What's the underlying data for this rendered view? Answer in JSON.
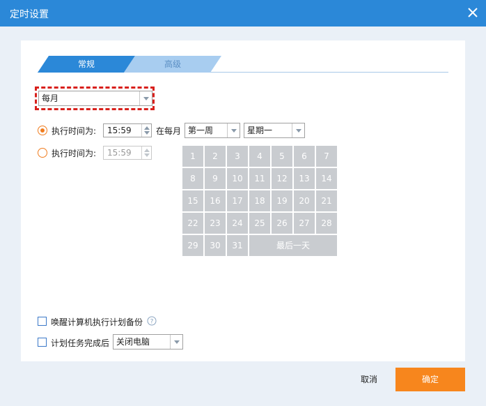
{
  "window": {
    "title": "定时设置"
  },
  "tabs": [
    {
      "label": "常规",
      "active": true
    },
    {
      "label": "高级",
      "active": false
    }
  ],
  "frequency": {
    "selected": "每月"
  },
  "radio_week": {
    "label": "执行时间为:",
    "selected": true,
    "time": "15:59",
    "each_month_label": "在每月",
    "week_selected": "第一周",
    "weekday_selected": "星期一"
  },
  "radio_day": {
    "label": "执行时间为:",
    "selected": false,
    "time": "15:59"
  },
  "calendar": {
    "days": [
      "1",
      "2",
      "3",
      "4",
      "5",
      "6",
      "7",
      "8",
      "9",
      "10",
      "11",
      "12",
      "13",
      "14",
      "15",
      "16",
      "17",
      "18",
      "19",
      "20",
      "21",
      "22",
      "23",
      "24",
      "25",
      "26",
      "27",
      "28",
      "29",
      "30",
      "31"
    ],
    "last_day_label": "最后一天"
  },
  "options": {
    "wake_label": "唤醒计算机执行计划备份",
    "after_label": "计划任务完成后",
    "after_selected": "关闭电脑"
  },
  "footer": {
    "cancel_label": "取消",
    "ok_label": "确定"
  },
  "colors": {
    "titlebar": "#2b88d8",
    "accent": "#f7861d",
    "tab_active": "#2b88d8",
    "tab_inactive": "#a8cdf0",
    "highlight": "#d8201c"
  }
}
